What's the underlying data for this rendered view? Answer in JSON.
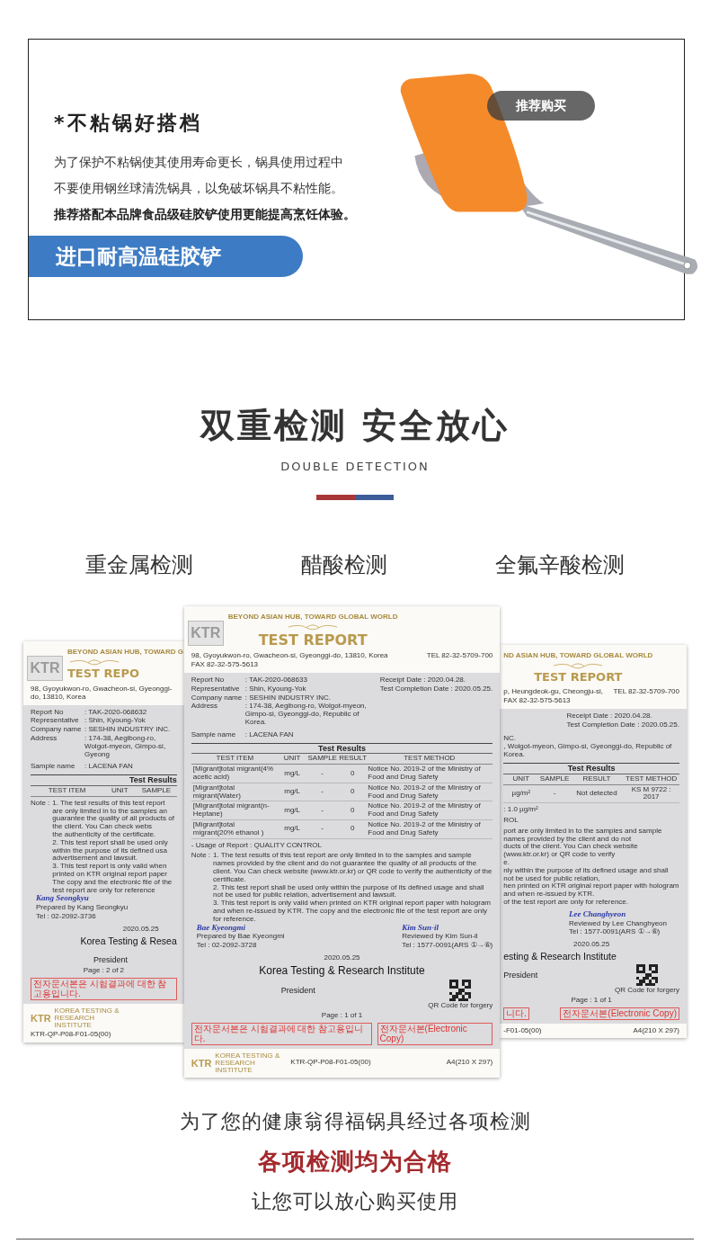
{
  "product_card": {
    "heading": "*不粘锅好搭档",
    "lines": [
      {
        "text": "为了保护不粘锅使其使用寿命更长，锅具使用过程中",
        "emphasis": false
      },
      {
        "text": "不要使用钢丝球清洗锅具，以免破坏锅具不粘性能。",
        "emphasis": false
      },
      {
        "text": "推荐搭配本品牌食品级硅胶铲使用更能提高烹饪体验。",
        "emphasis": true
      }
    ],
    "banner": "进口耐高温硅胶铲",
    "buy_button": "推荐购买"
  },
  "section": {
    "title": "双重检测 安全放心",
    "subtitle": "DOUBLE DETECTION"
  },
  "test_types": [
    "重金属检测",
    "醋酸检测",
    "全氟辛酸检测"
  ],
  "certificates": [
    {
      "kind": "side-left",
      "logo": "KTR",
      "slogan": "BEYOND ASIAN HUB, TOWARD G",
      "title": "TEST REPO",
      "address": "98, Gyoyukwon-ro, Gwacheon-si, Gyeonggi-do, 13810, Korea",
      "fields": [
        {
          "label": "Report No",
          "value": ": TAK-2020-068632"
        },
        {
          "label": "Representative",
          "value": ": Shin, Kyoung-Yok"
        },
        {
          "label": "Company name",
          "value": ": SESHIN INDUSTRY INC."
        },
        {
          "label": "Address",
          "value": ": 174-38, Aegibong-ro, Wolgot-myeon, Gimpo-si, Gyeong"
        }
      ],
      "sample": {
        "label": "Sample name",
        "value": ": LACENA FAN"
      },
      "results_title": "Test Results",
      "columns": [
        "TEST ITEM",
        "UNIT",
        "SAMPLE"
      ],
      "note_label": "Note :",
      "notes": [
        "1. The test results of this test report are only limited in to the samples an",
        "guarantee the quality of all products of the client. You Can check webs",
        "the authenticity of the certificate.",
        "2. This test report shall be used only within the purpose of its defined usa",
        "advertisement and lawsuit.",
        "3. This test report is only valid when printed on KTR original report paper",
        "The copy and the electronic file of the test report are only for reference"
      ],
      "signers": [
        {
          "signature": "Kang Seongkyu",
          "role": "Prepared by Kang Seongkyu",
          "tel": "Tel : 02-2092-3736"
        }
      ],
      "date": "2020.05.25",
      "institute": "Korea Testing & Resea",
      "president": "President",
      "page": "Page : 2 of 2",
      "red_notes": [
        "전자문서본은 시험결과에 대한 참고용입니다."
      ],
      "footer": {
        "logo": "KTR",
        "logo_sub": "KOREA TESTING & RESEARCH INSTITUTE",
        "code": "KTR-QP-P08-F01-05(00)"
      }
    },
    {
      "kind": "main",
      "logo": "KTR",
      "slogan": "BEYOND ASIAN HUB, TOWARD GLOBAL WORLD",
      "title": "TEST REPORT",
      "address": "98, Gyoyukwon-ro, Gwacheon-si, Gyeonggi-do, 13810, Korea",
      "tel": "TEL 82-32-5709-700",
      "fax": "FAX 82-32-575-5613",
      "fields": [
        {
          "label": "Report No",
          "value": ": TAK-2020-068633"
        },
        {
          "label": "Representative",
          "value": ": Shin, Kyoung-Yok"
        },
        {
          "label": "Company name",
          "value": ": SESHIN INDUSTRY INC."
        },
        {
          "label": "Address",
          "value": ": 174-38, Aegibong-ro, Wolgot-myeon, Gimpo-si, Gyeonggi-do, Republic of Korea."
        }
      ],
      "dates": [
        "Receipt Date : 2020.04.28.",
        "Test Completion Date : 2020.05.25."
      ],
      "sample": {
        "label": "Sample name",
        "value": ": LACENA FAN"
      },
      "results_title": "Test Results",
      "columns": [
        "TEST ITEM",
        "UNIT",
        "SAMPLE",
        "RESULT",
        "TEST METHOD"
      ],
      "rows": [
        [
          "[Migrant]total migrant(4% acetic acid)",
          "mg/L",
          "-",
          "0",
          "Notice No. 2019-2 of the Ministry of Food and Drug Safety"
        ],
        [
          "[Migrant]total migrant(Water)",
          "mg/L",
          "-",
          "0",
          "Notice No. 2019-2 of the Ministry of Food and Drug Safety"
        ],
        [
          "[Migrant]total migrant(n-Heptane)",
          "mg/L",
          "-",
          "0",
          "Notice No. 2019-2 of the Ministry of Food and Drug Safety"
        ],
        [
          "[Migrant]total migrant(20% ethanol )",
          "mg/L",
          "-",
          "0",
          "Notice No. 2019-2 of the Ministry of Food and Drug Safety"
        ]
      ],
      "usage": "- Usage of Report : QUALITY CONTROL",
      "note_label": "Note :",
      "notes": [
        "1. The test results of this test report are only limited in to the samples and sample names provided by the client and do not guarantee the quality of all products of the client. You Can check website (www.ktr.or.kr) or QR code to verify the authenticity of the certificate.",
        "2. This test report shall be used only within the purpose of its defined usage and shall not be used for public relation, advertisement and lawsuit.",
        "3. This test report is only valid when printed on KTR original report paper with hologram and when re-issued by KTR. The copy and the electronic file of the test report are only for reference."
      ],
      "signers": [
        {
          "signature": "Bae Kyeongmi",
          "role": "Prepared by Bae Kyeongmi",
          "tel": "Tel : 02-2092-3728"
        },
        {
          "signature": "Kim Sun-il",
          "role": "Reviewed by Kim Sun-il",
          "tel": "Tel : 1577-0091(ARS ①→⑥)"
        }
      ],
      "date": "2020.05.25",
      "institute": "Korea Testing & Research Institute",
      "president": "President",
      "qr_caption": "QR Code for forgery",
      "page": "Page : 1 of 1",
      "red_notes": [
        "전자문서본은 시험결과에 대한 참고용입니다.",
        "전자문서본(Electronic Copy)"
      ],
      "footer": {
        "logo": "KTR",
        "logo_sub": "KOREA TESTING & RESEARCH INSTITUTE",
        "code": "KTR-QP-P08-F01-05(00)",
        "size": "A4(210 X 297)"
      }
    },
    {
      "kind": "side-right",
      "slogan": "ND ASIAN HUB, TOWARD GLOBAL WORLD",
      "title": "TEST REPORT",
      "address": "p, Heungdeok-gu, Cheongju-si,",
      "tel": "TEL 82-32-5709-700",
      "fax": "FAX 82-32-575-5613",
      "dates": [
        "Receipt Date : 2020.04.28.",
        "Test Completion Date : 2020.05.25."
      ],
      "fields": [
        {
          "value": "NC."
        },
        {
          "value": ", Wolgot-myeon, Gimpo-si, Gyeonggi-do, Republic of Korea."
        }
      ],
      "results_title": "Test Results",
      "columns": [
        "UNIT",
        "SAMPLE",
        "RESULT",
        "TEST METHOD"
      ],
      "rows": [
        [
          "µg/m²",
          "-",
          "Not detected",
          "KS M 9722 : 2017"
        ]
      ],
      "limit": ": 1.0 µg/m²",
      "usage": "ROL",
      "notes": [
        "port are only limited in to the samples and sample names provided by the client and do not",
        "ducts of the client. You Can check website (www.ktr.or.kr) or QR code to verify",
        "e.",
        "nly within the purpose of its defined usage and shall not be used for public relation,",
        "hen printed on KTR original report paper with hologram and when re-issued by KTR.",
        "of the test report are only for reference."
      ],
      "signers": [
        {
          "signature": "Lee Changhyeon",
          "role": "Reviewed by Lee Changhyeon",
          "tel": "Tel : 1577-0091(ARS ①→⑥)"
        }
      ],
      "date": "2020.05.25",
      "institute": "esting & Research Institute",
      "president": "President",
      "qr_caption": "QR Code for forgery",
      "page": "Page : 1 of 1",
      "red_notes": [
        "니다.",
        "전자문서본(Electronic Copy)"
      ],
      "footer": {
        "code": "-F01-05(00)",
        "size": "A4(210 X 297)"
      }
    }
  ],
  "closing": {
    "lines": [
      {
        "text": "为了您的健康翁得福锅具经过各项检测",
        "emphasis": false
      },
      {
        "text": "各项检测均为合格",
        "emphasis": true
      },
      {
        "text": "让您可以放心购买使用",
        "emphasis": false
      }
    ]
  }
}
